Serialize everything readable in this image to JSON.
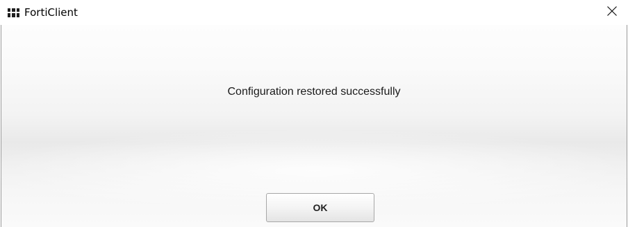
{
  "window": {
    "title": "FortiClient",
    "app_icon": "forticlient-logo-icon",
    "close_icon": "close-icon"
  },
  "dialog": {
    "message": "Configuration restored successfully",
    "ok_label": "OK"
  }
}
